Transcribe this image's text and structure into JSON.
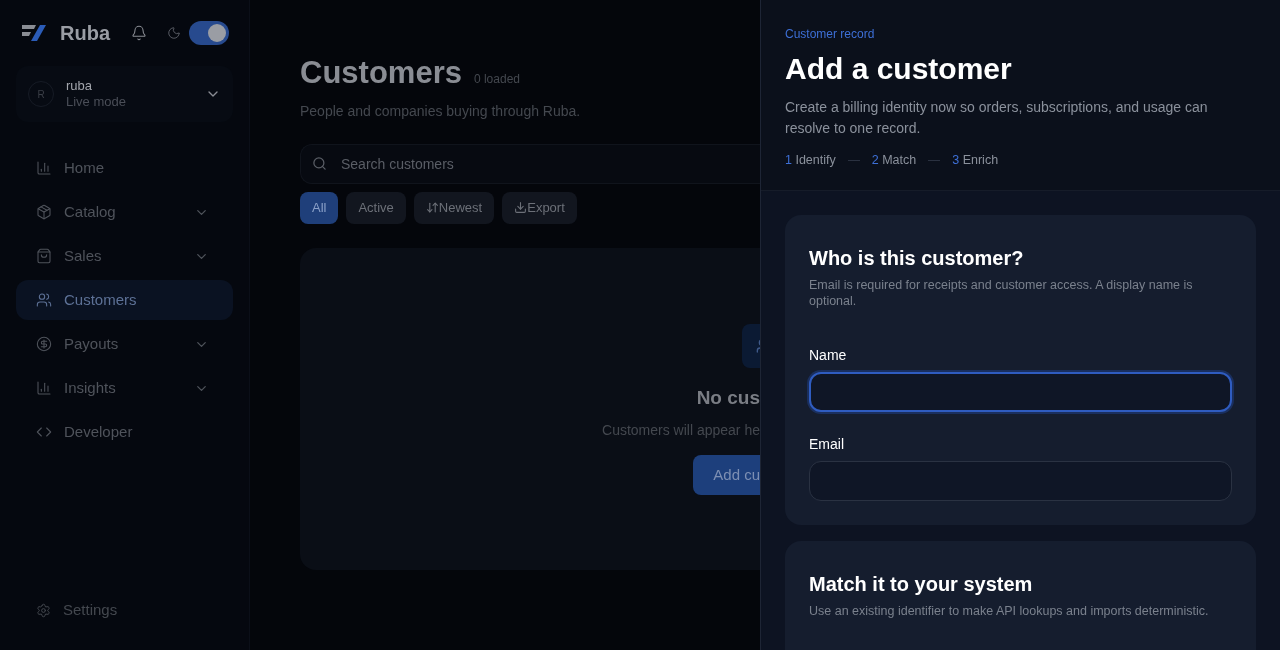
{
  "sidebar": {
    "brand": "Ruba",
    "theme_toggle": {
      "on": true
    },
    "account": {
      "avatar": "R",
      "name": "ruba",
      "mode": "Live mode"
    },
    "items": [
      {
        "kind": "chart",
        "label": "Home",
        "has_submenu": false,
        "selected": false
      },
      {
        "kind": "box",
        "label": "Catalog",
        "has_submenu": true,
        "selected": false
      },
      {
        "kind": "bag",
        "label": "Sales",
        "has_submenu": true,
        "selected": false
      },
      {
        "kind": "users",
        "label": "Customers",
        "has_submenu": false,
        "selected": true
      },
      {
        "kind": "dollar",
        "label": "Payouts",
        "has_submenu": true,
        "selected": false
      },
      {
        "kind": "chart",
        "label": "Insights",
        "has_submenu": true,
        "selected": false
      },
      {
        "kind": "code",
        "label": "Developer",
        "has_submenu": false,
        "selected": false
      }
    ],
    "footer": {
      "label": "Settings"
    }
  },
  "main": {
    "title": "Customers",
    "count": "0 loaded",
    "subtitle": "People and companies buying through Ruba.",
    "search": {
      "placeholder": "Search customers"
    },
    "filters": [
      {
        "kind": "plain",
        "label": "All",
        "selected": true
      },
      {
        "kind": "plain",
        "label": "Active",
        "selected": false
      },
      {
        "kind": "sort",
        "label": "Newest",
        "selected": false
      },
      {
        "kind": "export",
        "label": "Export",
        "selected": false
      }
    ],
    "empty_state": {
      "title": "No cus",
      "text": "Customers will appear he",
      "button": "Add cu"
    }
  },
  "drawer": {
    "eyebrow": "Customer record",
    "title": "Add a customer",
    "description": "Create a billing identity now so orders, subscriptions, and usage can resolve to one record.",
    "steps": [
      {
        "number": "1",
        "label": "Identify"
      },
      {
        "number": "2",
        "label": "Match"
      },
      {
        "number": "3",
        "label": "Enrich"
      }
    ],
    "sections": [
      {
        "title": "Who is this customer?",
        "description": "Email is required for receipts and customer access. A display name is optional.",
        "fields": [
          {
            "label": "Name",
            "focused": true
          },
          {
            "label": "Email",
            "focused": false
          }
        ]
      },
      {
        "title": "Match it to your system",
        "description": "Use an existing identifier to make API lookups and imports deterministic."
      }
    ]
  }
}
